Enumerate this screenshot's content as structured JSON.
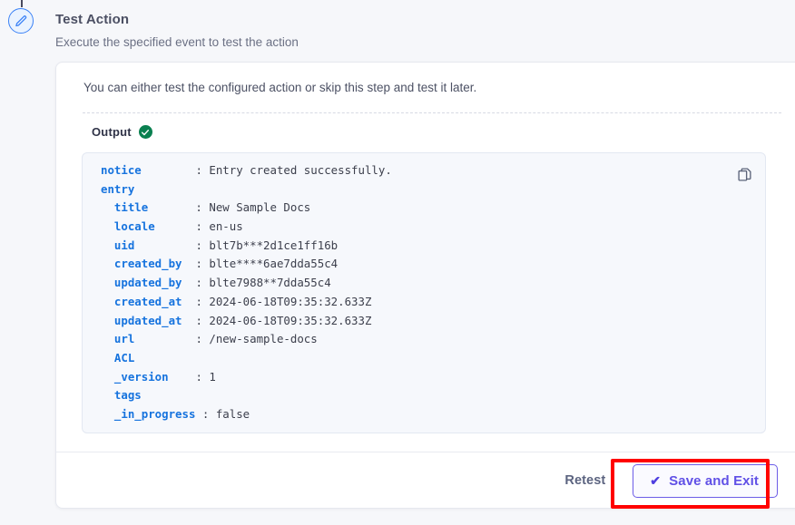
{
  "step": {
    "icon": "pencil-edit-icon",
    "accent_color": "#3b82f6"
  },
  "header": {
    "title": "Test Action",
    "subtitle": "Execute the specified event to test the action"
  },
  "card": {
    "intro_text": "You can either test the configured action or skip this step and test it later.",
    "output": {
      "label": "Output",
      "status_icon": "check-circle-icon",
      "status_color": "#0a8050",
      "copy_icon": "copy-icon",
      "lines": [
        {
          "indent": 0,
          "key": "notice",
          "sep": ":",
          "value": "Entry created successfully."
        },
        {
          "indent": 0,
          "key": "entry",
          "sep": "",
          "value": ""
        },
        {
          "indent": 1,
          "key": "title",
          "sep": ":",
          "value": "New Sample Docs"
        },
        {
          "indent": 1,
          "key": "locale",
          "sep": ":",
          "value": "en-us"
        },
        {
          "indent": 1,
          "key": "uid",
          "sep": ":",
          "value": "blt7b***2d1ce1ff16b"
        },
        {
          "indent": 1,
          "key": "created_by",
          "sep": ":",
          "value": "blte****6ae7dda55c4"
        },
        {
          "indent": 1,
          "key": "updated_by",
          "sep": ":",
          "value": "blte7988**7dda55c4"
        },
        {
          "indent": 1,
          "key": "created_at",
          "sep": ":",
          "value": "2024-06-18T09:35:32.633Z"
        },
        {
          "indent": 1,
          "key": "updated_at",
          "sep": ":",
          "value": "2024-06-18T09:35:32.633Z"
        },
        {
          "indent": 1,
          "key": "url",
          "sep": ":",
          "value": "/new-sample-docs"
        },
        {
          "indent": 1,
          "key": "ACL",
          "sep": "",
          "value": ""
        },
        {
          "indent": 1,
          "key": "_version",
          "sep": ":",
          "value": "1"
        },
        {
          "indent": 1,
          "key": "tags",
          "sep": "",
          "value": ""
        },
        {
          "indent": 1,
          "key": "_in_progress",
          "sep": ":",
          "value": "false"
        }
      ]
    },
    "footer": {
      "retest_label": "Retest",
      "save_label": "Save and Exit",
      "save_icon": "check-icon",
      "save_accent_color": "#6050e6"
    }
  },
  "annotation": {
    "target": "save-and-exit-button",
    "color": "#ff0000"
  }
}
